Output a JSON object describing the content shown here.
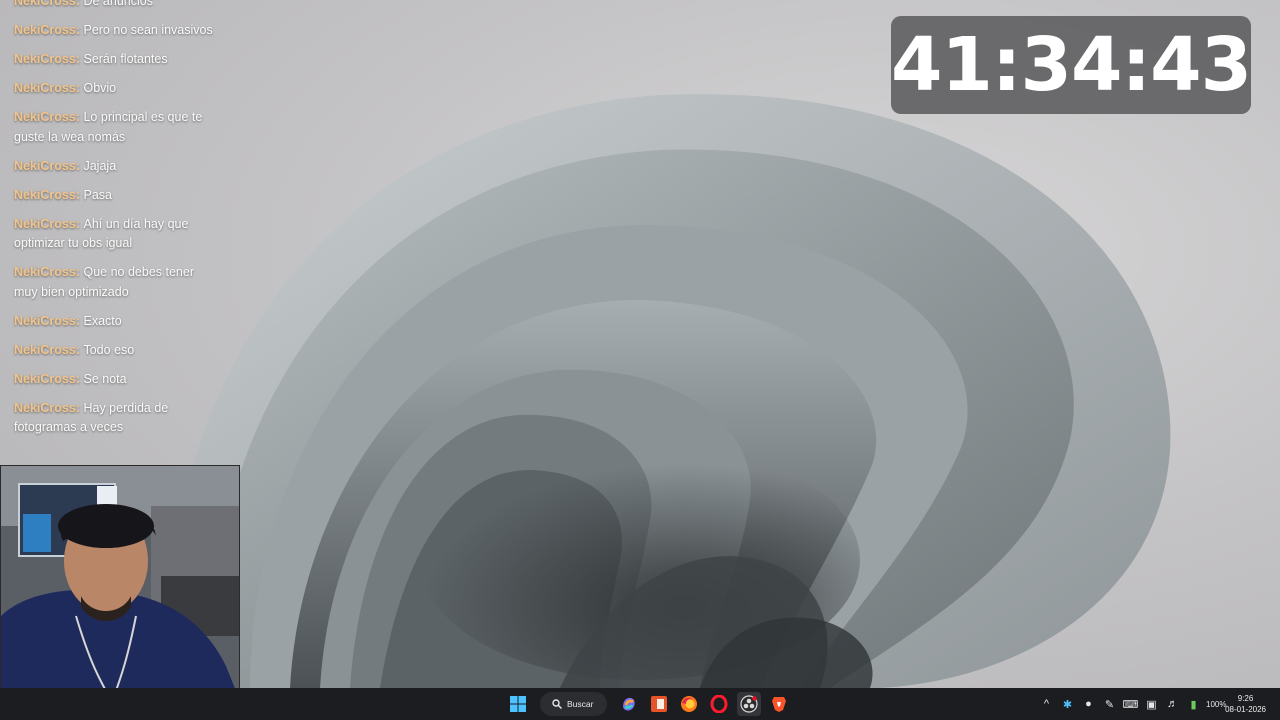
{
  "chat": {
    "messages": [
      {
        "user": "NekiCross",
        "text": "De anuncios"
      },
      {
        "user": "NekiCross",
        "text": "Pero no sean invasivos"
      },
      {
        "user": "NekiCross",
        "text": "Serán flotantes"
      },
      {
        "user": "NekiCross",
        "text": "Obvio"
      },
      {
        "user": "NekiCross",
        "text": "Lo principal es que te guste la wea nomás"
      },
      {
        "user": "NekiCross",
        "text": "Jajaja"
      },
      {
        "user": "NekiCross",
        "text": "Pasa"
      },
      {
        "user": "NekiCross",
        "text": "Ahí un día hay que optimizar tu obs igual"
      },
      {
        "user": "NekiCross",
        "text": "Que no debes tener muy bien optimizado"
      },
      {
        "user": "NekiCross",
        "text": "Exacto"
      },
      {
        "user": "NekiCross",
        "text": "Todo eso"
      },
      {
        "user": "NekiCross",
        "text": "Se nota"
      },
      {
        "user": "NekiCross",
        "text": "Hay perdida de fotogramas a veces"
      }
    ]
  },
  "timer": {
    "value": "41:34:43"
  },
  "taskbar": {
    "search_label": "Buscar",
    "apps": [
      "windows-start-icon",
      "search-icon",
      "copilot-icon",
      "office-icon",
      "firefox-icon",
      "opera-icon",
      "obs-icon",
      "brave-icon"
    ],
    "tray": {
      "battery_percent": "100%",
      "time": "9:26",
      "date": "08-01-2026"
    }
  },
  "colors": {
    "chat_username": "#f3c48a",
    "taskbar_bg": "#1c1d21",
    "timer_bg": "#5c5c5e"
  }
}
